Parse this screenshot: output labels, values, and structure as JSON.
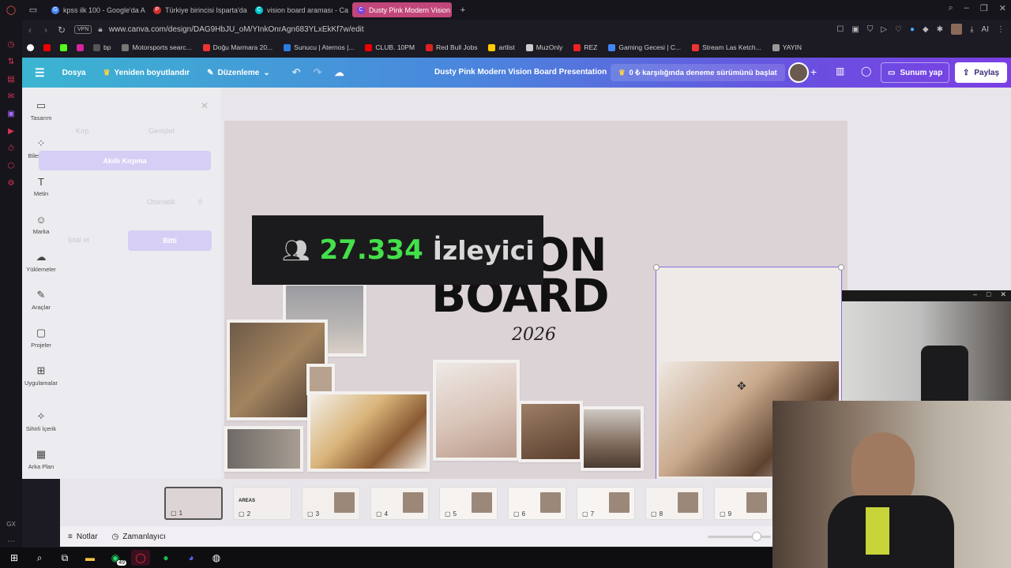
{
  "browser": {
    "tabs": [
      {
        "label": "kpss ilk 100 - Google'da A",
        "fav": "G",
        "color": "#4285f4"
      },
      {
        "label": "Türkiye birincisi Isparta'da",
        "fav": "P",
        "color": "#d32f2f"
      },
      {
        "label": "vision board araması - Ca",
        "fav": "C",
        "color": "#00c4cc"
      },
      {
        "label": "Dusty Pink Modern Vision",
        "fav": "C",
        "color": "#7b3fe4",
        "active": true
      }
    ],
    "new_tab": "+",
    "url": "www.canva.com/design/DAG9HbJU_oM/YInkOnrAgn683YLxEkKf7w/edit",
    "vpn": "VPN",
    "ai_label": "AI"
  },
  "bookmarks": [
    {
      "label": "bp",
      "color": "#555"
    },
    {
      "label": "Motorsports searc...",
      "color": "#777"
    },
    {
      "label": "Doğu Marmara 20...",
      "color": "#e33"
    },
    {
      "label": "Sunucu | Aternos |...",
      "color": "#2a7de1"
    },
    {
      "label": "CLUB. 10PM",
      "color": "#e00"
    },
    {
      "label": "Red Bull Jobs",
      "color": "#d22"
    },
    {
      "label": "artlist",
      "color": "#fc0"
    },
    {
      "label": "MuzOnly",
      "color": "#ccc"
    },
    {
      "label": "REZ",
      "color": "#e22"
    },
    {
      "label": "Gaming Gecesi | C...",
      "color": "#4285f4"
    },
    {
      "label": "Stream Las Ketch...",
      "color": "#e33"
    },
    {
      "label": "YAYIN",
      "color": "#999"
    }
  ],
  "canva": {
    "menu": {
      "file": "Dosya",
      "resize": "Yeniden boyutlandır",
      "edit": "Düzenleme"
    },
    "doc_title": "Dusty Pink Modern Vision Board Presentation",
    "trial": "0 ₺ karşılığında deneme sürümünü başlat",
    "present": "Sunum yap",
    "share": "Paylaş",
    "rail": [
      {
        "label": "Tasarım",
        "icon": "▭"
      },
      {
        "label": "Bileşenler",
        "icon": "⁘"
      },
      {
        "label": "Metin",
        "icon": "T"
      },
      {
        "label": "Marka",
        "icon": "☺"
      },
      {
        "label": "Yüklemeler",
        "icon": "☁"
      },
      {
        "label": "Araçlar",
        "icon": "✎"
      },
      {
        "label": "Projeler",
        "icon": "▢"
      },
      {
        "label": "Uygulamalar",
        "icon": "⊞"
      },
      {
        "label": "Sihirli İçerik",
        "icon": "✧"
      },
      {
        "label": "Arka Plan",
        "icon": "▦"
      }
    ],
    "panel": {
      "crop": "Kırp",
      "expand": "Genişlet",
      "smart_crop": "Akıllı Kırpma",
      "auto": "Otomatik",
      "auto_value": "0",
      "cancel": "İptal et",
      "done": "Bitti"
    },
    "slide": {
      "title_line1": "VISION",
      "title_line2": "BOARD",
      "year": "2026"
    },
    "thumbnails": [
      "1",
      "2",
      "3",
      "4",
      "5",
      "6",
      "7",
      "8",
      "9"
    ],
    "thumb_labels": {
      "t2": "AREAS"
    },
    "footer": {
      "notes": "Notlar",
      "timer": "Zamanlayıcı"
    }
  },
  "overlay": {
    "viewer_count": "27.334",
    "viewer_label": "İzleyici"
  },
  "taskbar": {
    "whatsapp_badge": "49"
  }
}
